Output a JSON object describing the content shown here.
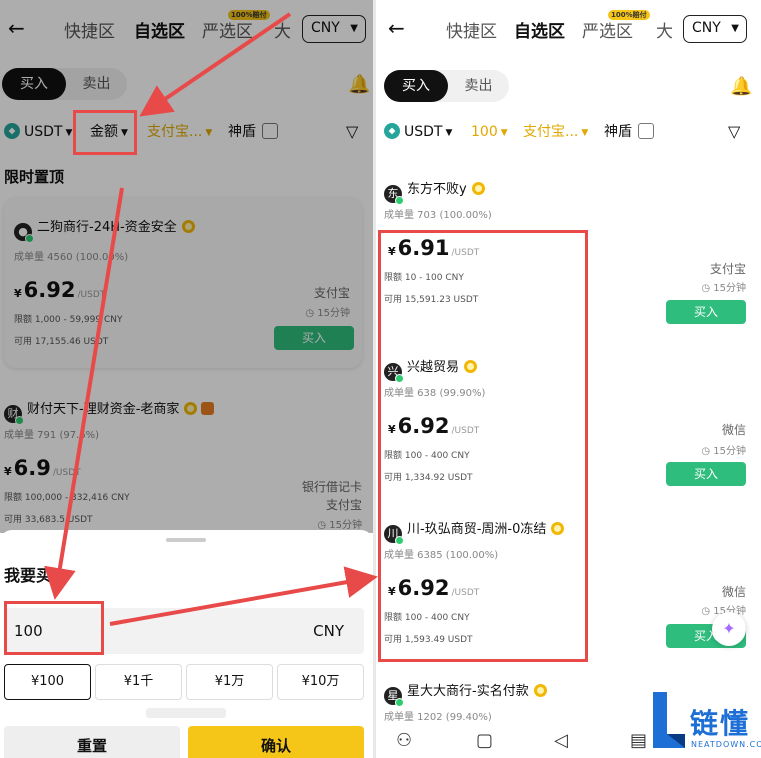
{
  "nav": {
    "back": "←",
    "tabs": [
      "快捷区",
      "自选区",
      "严选区",
      "大"
    ],
    "hot_tag": "100%赔付",
    "currency": "CNY"
  },
  "toggle": {
    "buy": "买入",
    "sell": "卖出"
  },
  "left": {
    "filter": {
      "coin": "USDT",
      "amount": "金额",
      "payment": "支付宝...",
      "shield": "神盾"
    },
    "pinned_title": "限时置顶",
    "card1": {
      "name": "二狗商行-24H-资金安全",
      "stats": "成单量 4560 (100.00%)",
      "yen": "¥",
      "price": "6.92",
      "unit": "/USDT",
      "limit": "限额 1,000 - 59,999 CNY",
      "avail": "可用 17,155.46 USDT",
      "pay": "支付宝",
      "time": "15分钟",
      "btn": "买入"
    },
    "card2": {
      "name": "财付天下-理财资金-老商家",
      "stats": "成单量 791 (97.6%)",
      "yen": "¥",
      "price": "6.9",
      "unit": "/USDT",
      "limit": "限额 100,000 - 332,416 CNY",
      "avail": "可用 33,683.5 USDT",
      "pay1": "银行借记卡",
      "pay2": "支付宝",
      "time": "15分钟"
    },
    "sheet": {
      "title": "我要买",
      "amount": "100",
      "currency": "CNY",
      "quick": [
        "¥100",
        "¥1千",
        "¥1万",
        "¥10万"
      ],
      "reset": "重置",
      "confirm": "确认"
    }
  },
  "right": {
    "filter": {
      "coin": "USDT",
      "amount": "100",
      "payment": "支付宝...",
      "shield": "神盾"
    },
    "cards": [
      {
        "avatar": "东",
        "name": "东方不败y",
        "stats": "成单量 703 (100.00%)",
        "yen": "¥",
        "price": "6.91",
        "unit": "/USDT",
        "limit": "限额 10 - 100 CNY",
        "avail": "可用 15,591.23 USDT",
        "pay": "支付宝",
        "time": "15分钟",
        "btn": "买入"
      },
      {
        "avatar": "兴",
        "name": "兴越贸易",
        "stats": "成单量 638 (99.90%)",
        "yen": "¥",
        "price": "6.92",
        "unit": "/USDT",
        "limit": "限额 100 - 400 CNY",
        "avail": "可用 1,334.92 USDT",
        "pay": "微信",
        "time": "15分钟",
        "btn": "买入"
      },
      {
        "avatar": "川",
        "name": "川-玖弘商贸-周洲-0冻结",
        "stats": "成单量 6385 (100.00%)",
        "yen": "¥",
        "price": "6.92",
        "unit": "/USDT",
        "limit": "限额 100 - 400 CNY",
        "avail": "可用 1,593.49 USDT",
        "pay": "微信",
        "time": "15分钟",
        "btn": "买入"
      },
      {
        "avatar": "星",
        "name": "星大大商行-实名付款",
        "stats": "成单量 1202 (99.40%)"
      }
    ]
  },
  "watermark": {
    "text": "链懂",
    "sub": "NEATDOWN.COM"
  },
  "colors": {
    "accent_yellow": "#f5c518",
    "buy_green": "#2ebd7c",
    "highlight_red": "#e84a4a"
  }
}
